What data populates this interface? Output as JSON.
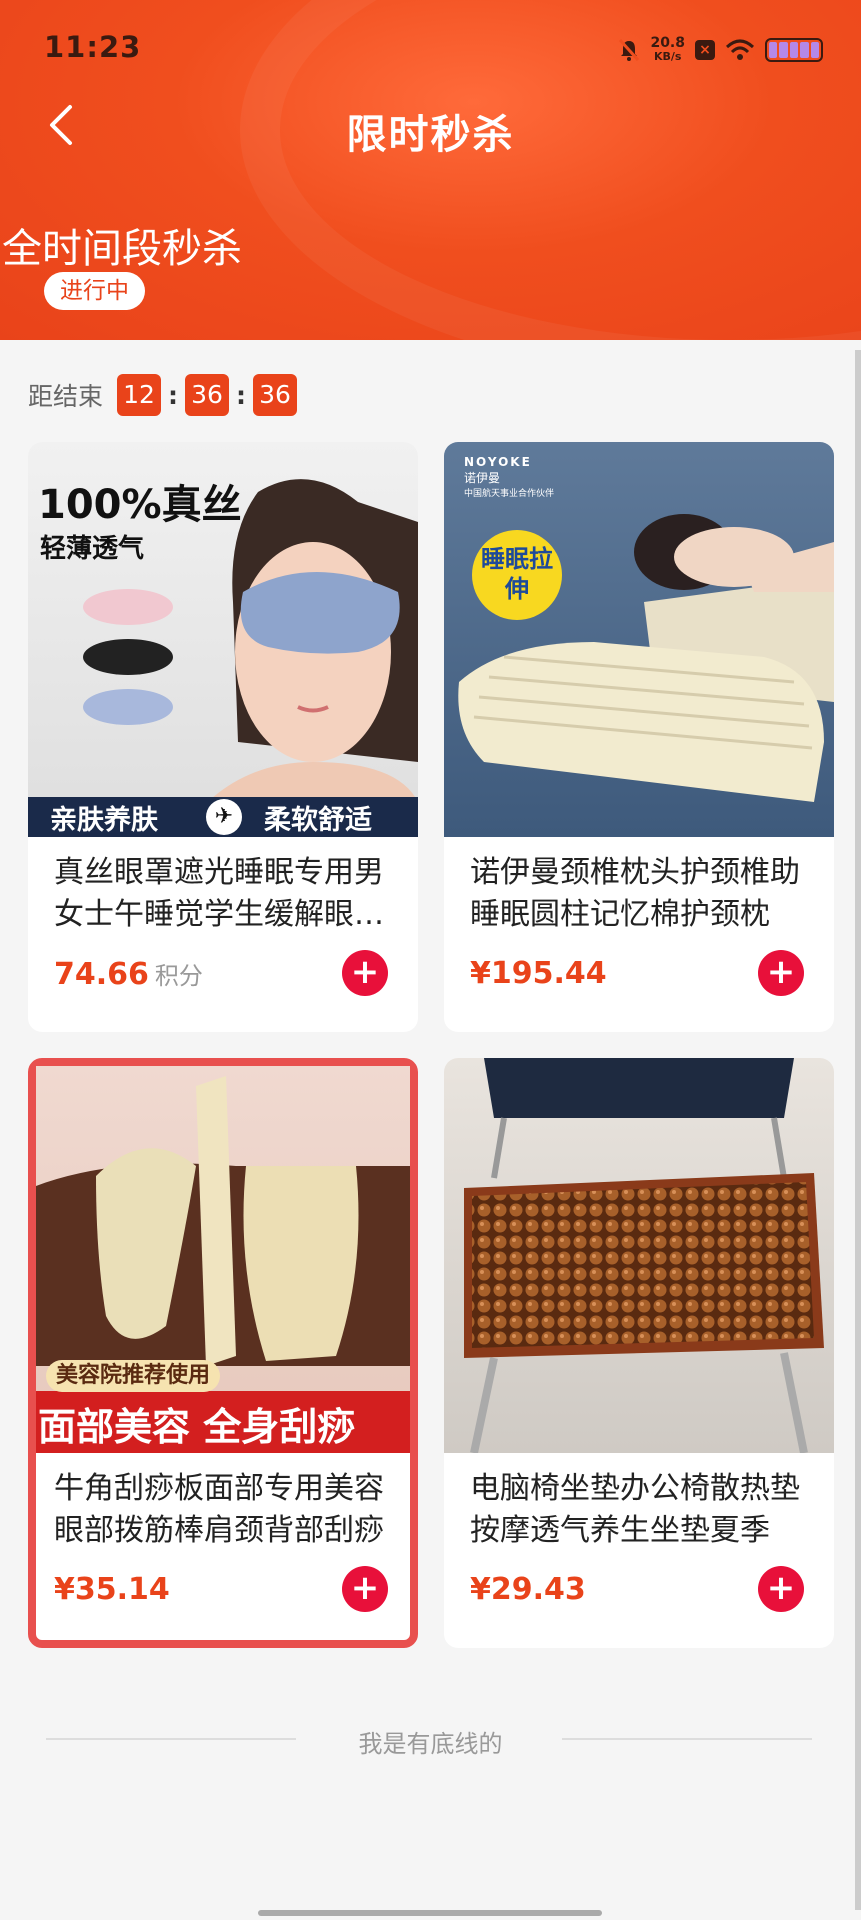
{
  "status_bar": {
    "time": "11:23",
    "net_speed": "20.8",
    "net_unit": "KB/s"
  },
  "header": {
    "title": "限时秒杀",
    "session_title": "全时间段秒杀",
    "session_status": "进行中"
  },
  "countdown": {
    "label": "距结束",
    "hours": "12",
    "minutes": "36",
    "seconds": "36",
    "separator": ":"
  },
  "products": [
    {
      "name": "真丝眼罩遮光睡眠专用男女士午睡觉学生缓解眼疲劳",
      "price": "74.66",
      "currency": "",
      "unit": "积分",
      "image": {
        "headline": "100%真丝",
        "subline": "轻薄透气",
        "banner_left": "亲肤养肤",
        "banner_right": "柔软舒适"
      }
    },
    {
      "name": "诺伊曼颈椎枕头护颈椎助睡眠圆柱记忆棉护颈枕",
      "price": "195.44",
      "currency": "¥",
      "unit": "",
      "image": {
        "brand": "NOYOKE",
        "brand_cn": "诺伊曼",
        "brand_sub": "中国航天事业合作伙伴",
        "badge": "睡眠拉伸"
      }
    },
    {
      "name": "牛角刮痧板面部专用美容眼部拨筋棒肩颈背部刮痧",
      "price": "35.14",
      "currency": "¥",
      "unit": "",
      "image": {
        "tag": "美容院推荐使用",
        "banner": "面部美容 全身刮痧"
      }
    },
    {
      "name": "电脑椅坐垫办公椅散热垫按摩透气养生坐垫夏季",
      "price": "29.43",
      "currency": "¥",
      "unit": "",
      "image": {}
    }
  ],
  "footer": {
    "text": "我是有底线的"
  }
}
